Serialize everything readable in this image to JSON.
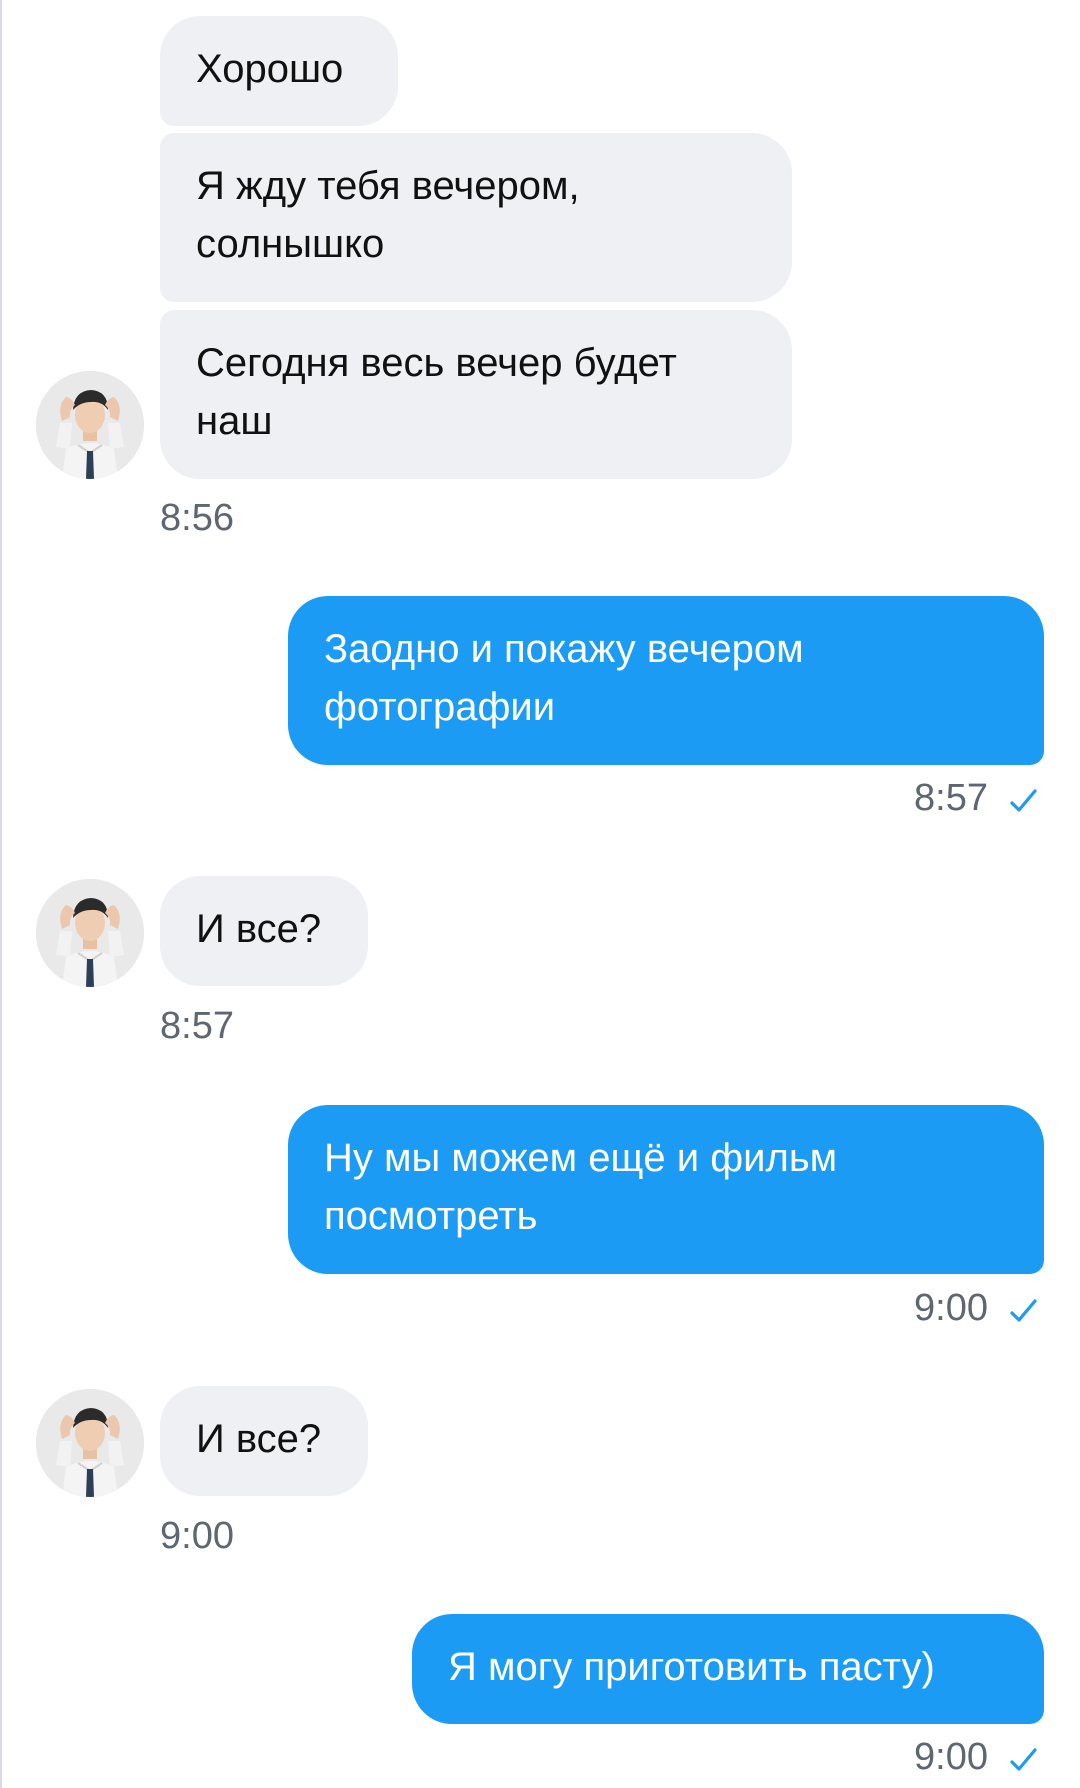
{
  "colors": {
    "incoming_bubble": "#eff0f4",
    "outgoing_bubble": "#1b9bf4",
    "check": "#1b9bf4",
    "timestamp": "#5f6670"
  },
  "messages": [
    {
      "direction": "in",
      "text": "Хорошо"
    },
    {
      "direction": "in",
      "text": "Я жду тебя вечером,\nсолнышко"
    },
    {
      "direction": "in",
      "text": "Сегодня весь вечер будет\nнаш",
      "time": "8:56"
    },
    {
      "direction": "out",
      "text": "Заодно и покажу вечером\nфотографии",
      "time": "8:57",
      "status_icon": "check-icon"
    },
    {
      "direction": "in",
      "text": "И все?",
      "time": "8:57"
    },
    {
      "direction": "out",
      "text": "Ну мы можем ещё и фильм\nпосмотреть",
      "time": "9:00",
      "status_icon": "check-icon"
    },
    {
      "direction": "in",
      "text": "И все?",
      "time": "9:00"
    },
    {
      "direction": "out",
      "text": "Я могу приготовить пасту)",
      "time": "9:00",
      "status_icon": "check-icon"
    }
  ]
}
